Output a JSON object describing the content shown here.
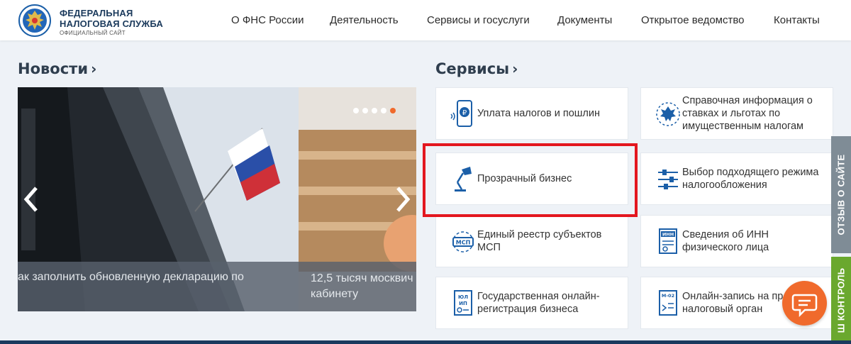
{
  "header": {
    "brand_line1": "ФЕДЕРАЛЬНАЯ",
    "brand_line2": "НАЛОГОВАЯ СЛУЖБА",
    "brand_sub": "ОФИЦИАЛЬНЫЙ САЙТ",
    "nav": [
      "О ФНС России",
      "Деятельность",
      "Сервисы и госуслуги",
      "Документы",
      "Открытое ведомство",
      "Контакты"
    ]
  },
  "news": {
    "title": "Новости",
    "slides": [
      {
        "caption": "ак заполнить обновленную декларацию по"
      },
      {
        "caption": "12,5 тысяч москвич кабинету"
      }
    ],
    "dots": 5,
    "active_dot": 5
  },
  "services": {
    "title": "Сервисы",
    "items": [
      {
        "label": "Уплата налогов и пошлин",
        "icon": "phone-ruble-icon"
      },
      {
        "label": "Справочная информация о ставках и льготах по имущественным налогам",
        "icon": "eagle-emblem-icon"
      },
      {
        "label": "Прозрачный бизнес",
        "icon": "desk-lamp-icon"
      },
      {
        "label": "Выбор подходящего режима налогообложения",
        "icon": "sliders-icon"
      },
      {
        "label": "Единый реестр субъектов МСП",
        "icon": "msp-network-icon"
      },
      {
        "label": "Сведения об ИНН физического лица",
        "icon": "inn-document-icon"
      },
      {
        "label": "Государственная онлайн-регистрация бизнеса",
        "icon": "ul-ip-document-icon"
      },
      {
        "label": "Онлайн-запись на пр налоговый орган",
        "icon": "form-m02-icon"
      }
    ]
  },
  "side_tabs": {
    "feedback": "ОТЗЫВ О САЙТЕ",
    "control": "Ш КОНТРОЛЬ"
  },
  "colors": {
    "accent": "#f06a2c",
    "brand_blue": "#1b5fa8",
    "highlight": "#e3171f",
    "feedback_tab": "#7f8c96",
    "control_tab": "#6aa82e"
  }
}
